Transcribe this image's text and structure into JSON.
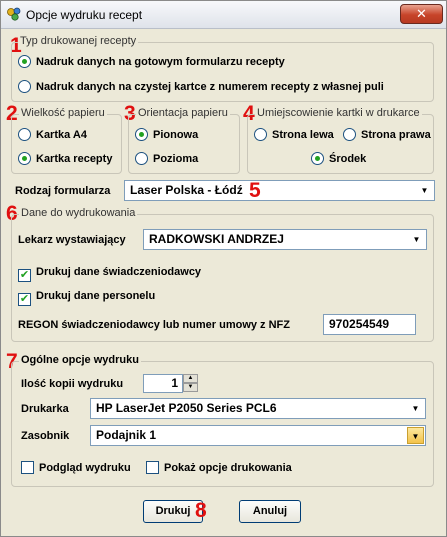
{
  "window": {
    "title": "Opcje wydruku recept",
    "close_label": "✕"
  },
  "annotations": [
    "1",
    "2",
    "3",
    "4",
    "5",
    "6",
    "7",
    "8"
  ],
  "typ": {
    "legend": "Typ drukowanej recepty",
    "options": [
      {
        "label": "Nadruk danych na gotowym formularzu recepty",
        "selected": true
      },
      {
        "label": "Nadruk danych na czystej kartce z numerem recepty z własnej puli",
        "selected": false
      }
    ]
  },
  "wielkosc": {
    "legend": "Wielkość papieru",
    "options": [
      {
        "label": "Kartka A4",
        "selected": false
      },
      {
        "label": "Kartka recepty",
        "selected": true
      }
    ]
  },
  "orientacja": {
    "legend": "Orientacja papieru",
    "options": [
      {
        "label": "Pionowa",
        "selected": true
      },
      {
        "label": "Pozioma",
        "selected": false
      }
    ]
  },
  "umiejscowienie": {
    "legend": "Umiejscowienie kartki w drukarce",
    "options": [
      {
        "label": "Strona lewa",
        "selected": false
      },
      {
        "label": "Strona prawa",
        "selected": false
      },
      {
        "label": "Środek",
        "selected": true
      }
    ]
  },
  "rodzaj": {
    "label": "Rodzaj formularza",
    "value": "Laser Polska - Łódź"
  },
  "dane": {
    "legend": "Dane do wydrukowania",
    "lekarz_label": "Lekarz wystawiający",
    "lekarz_value": "RADKOWSKI ANDRZEJ",
    "chk_swiad": {
      "label": "Drukuj dane świadczeniodawcy",
      "checked": true
    },
    "chk_personel": {
      "label": "Drukuj dane personelu",
      "checked": true
    },
    "regon_label": "REGON świadczeniodawcy lub numer umowy z NFZ",
    "regon_value": "970254549"
  },
  "ogolne": {
    "legend": "Ogólne opcje wydruku",
    "kopie_label": "Ilość kopii wydruku",
    "kopie_value": "1",
    "drukarka_label": "Drukarka",
    "drukarka_value": "HP LaserJet P2050 Series PCL6",
    "zasobnik_label": "Zasobnik",
    "zasobnik_value": "Podajnik 1",
    "podglad": {
      "label": "Podgląd wydruku",
      "checked": false
    },
    "pokaz": {
      "label": "Pokaż opcje drukowania",
      "checked": false
    }
  },
  "buttons": {
    "print": "Drukuj",
    "cancel": "Anuluj"
  },
  "icons": {
    "check_glyph": "✔",
    "arrow_down": "▼",
    "arrow_up": "▲"
  }
}
